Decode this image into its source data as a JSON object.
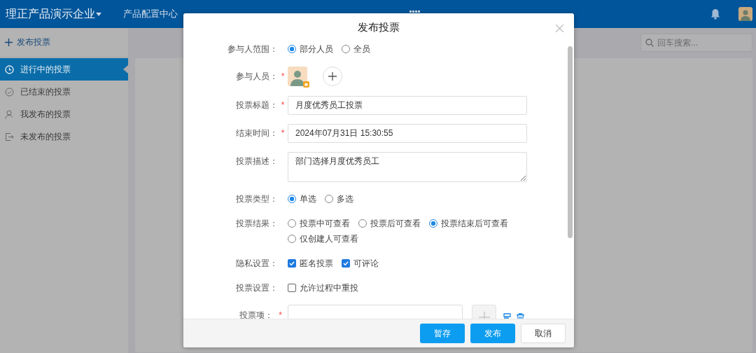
{
  "topbar": {
    "company": "理正产品演示企业",
    "nav": [
      {
        "label": "产品配置中心",
        "selected": false
      }
    ]
  },
  "sidebar": {
    "action": "发布投票",
    "items": [
      {
        "label": "进行中的投票",
        "selected": true
      },
      {
        "label": "已结束的投票",
        "selected": false
      },
      {
        "label": "我发布的投票",
        "selected": false
      },
      {
        "label": "未发布的投票",
        "selected": false
      }
    ]
  },
  "search": {
    "placeholder": "回车搜索..."
  },
  "dialog": {
    "title": "发布投票",
    "fields": [
      {
        "kind": "radio",
        "label": "参与人范围：",
        "options": [
          {
            "label": "部分人员",
            "selected": true
          },
          {
            "label": "全员",
            "selected": false
          }
        ]
      },
      {
        "kind": "people",
        "label": "参与人员：",
        "mark": "*"
      },
      {
        "kind": "text",
        "label": "投票标题：",
        "mark": "*",
        "value": "月度优秀员工投票"
      },
      {
        "kind": "text",
        "label": "结束时间：",
        "mark": "*",
        "value": "2024年07月31日 15:30:55"
      },
      {
        "kind": "textarea",
        "label": "投票描述：",
        "value": "部门选择月度优秀员工"
      },
      {
        "kind": "radio",
        "label": "投票类型：",
        "options": [
          {
            "label": "单选",
            "selected": true
          },
          {
            "label": "多选",
            "selected": false
          }
        ]
      },
      {
        "kind": "radio",
        "label": "投票结果：",
        "options": [
          {
            "label": "投票中可查看",
            "selected": false
          },
          {
            "label": "投票后可查看",
            "selected": false
          },
          {
            "label": "投票结束后可查看",
            "selected": true
          },
          {
            "label": "仅创建人可查看",
            "selected": false
          }
        ]
      },
      {
        "kind": "checkbox",
        "label": "隐私设置：",
        "options": [
          {
            "label": "匿名投票",
            "checked": true
          },
          {
            "label": "可评论",
            "checked": true
          }
        ]
      },
      {
        "kind": "checkbox",
        "label": "投票设置：",
        "options": [
          {
            "label": "允许过程中重投",
            "checked": false
          }
        ]
      },
      {
        "kind": "option",
        "label": "投票项：",
        "mark": "*"
      }
    ],
    "buttons": [
      {
        "label": "暂存",
        "kind": "primary"
      },
      {
        "label": "发布",
        "kind": "primary"
      },
      {
        "label": "取消",
        "kind": "default"
      }
    ]
  }
}
